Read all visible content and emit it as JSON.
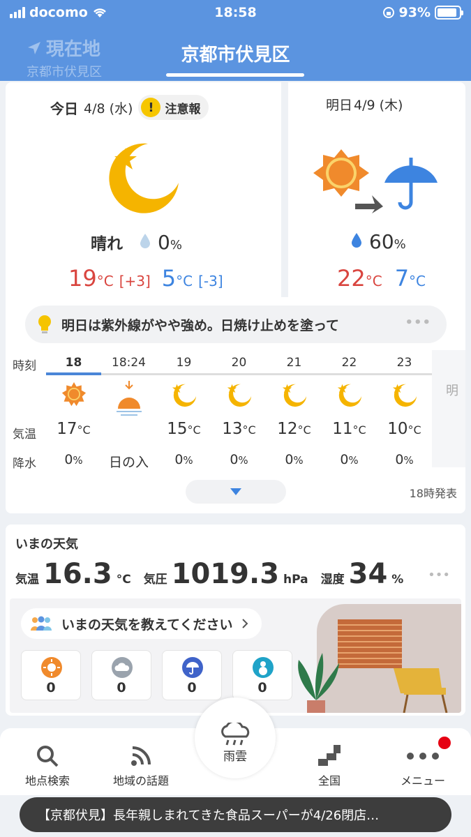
{
  "status": {
    "carrier": "docomo",
    "time": "18:58",
    "battery": "93%"
  },
  "header": {
    "ghost_title": "現在地",
    "ghost_sub": "京都市伏見区",
    "location": "京都市伏見区"
  },
  "today": {
    "label": "今日",
    "date": "4/8 (水)",
    "alert": "注意報",
    "alert_icon": "!",
    "weather_icon": "moon-icon",
    "desc": "晴れ",
    "rain_pct": "0",
    "pct_unit": "%",
    "high": "19",
    "high_diff": "[+3]",
    "low": "5",
    "low_diff": "[-3]",
    "temp_unit": "°C"
  },
  "tomorrow": {
    "label": "明日",
    "date": "4/9 (木)",
    "weather_icon": "sun-then-umbrella-icon",
    "rain_pct": "60",
    "pct_unit": "%",
    "high": "22",
    "low": "7",
    "temp_unit": "°C"
  },
  "tip": {
    "text": "明日は紫外線がやや強め。日焼け止めを塗って",
    "more": "•••"
  },
  "hourly": {
    "row_labels": {
      "time": "時刻",
      "temp": "気温",
      "rain": "降水"
    },
    "next_day": "明",
    "hours": [
      {
        "time": "18",
        "icon": "sun-icon",
        "temp": "17",
        "rain": "0"
      },
      {
        "time": "18:24",
        "icon": "sunset-icon",
        "temp": "",
        "rain": "日の入"
      },
      {
        "time": "19",
        "icon": "moon-icon",
        "temp": "15",
        "rain": "0"
      },
      {
        "time": "20",
        "icon": "moon-icon",
        "temp": "13",
        "rain": "0"
      },
      {
        "time": "21",
        "icon": "moon-icon",
        "temp": "12",
        "rain": "0"
      },
      {
        "time": "22",
        "icon": "moon-icon",
        "temp": "11",
        "rain": "0"
      },
      {
        "time": "23",
        "icon": "moon-icon",
        "temp": "10",
        "rain": "0"
      }
    ],
    "temp_unit": "°C",
    "rain_unit": "%"
  },
  "issued": "18時発表",
  "now": {
    "title": "いまの天気",
    "temp_label": "気温",
    "temp": "16.3",
    "temp_unit": "°C",
    "pressure_label": "気圧",
    "pressure": "1019.3",
    "pressure_unit": "hPa",
    "humidity_label": "湿度",
    "humidity": "34",
    "humidity_unit": "%",
    "more": "•••",
    "ask": "いまの天気を教えてください",
    "votes": [
      {
        "icon": "sun-icon",
        "count": "0",
        "color": "#f08a2c"
      },
      {
        "icon": "cloud-icon",
        "count": "0",
        "color": "#9aa3ad"
      },
      {
        "icon": "rain-umbrella-icon",
        "count": "0",
        "color": "#3f63c9"
      },
      {
        "icon": "snowman-icon",
        "count": "0",
        "color": "#1fa3c8"
      }
    ]
  },
  "tabs": {
    "search": "地点検索",
    "topics": "地域の話題",
    "rain": "雨雲",
    "national": "全国",
    "menu": "メニュー"
  },
  "ticker": "【京都伏見】長年親しまれてきた食品スーパーが4/26閉店…",
  "colors": {
    "accent": "#5b94e0",
    "hot": "#d9453f",
    "cold": "#3d84e0",
    "sun": "#f5b400"
  }
}
